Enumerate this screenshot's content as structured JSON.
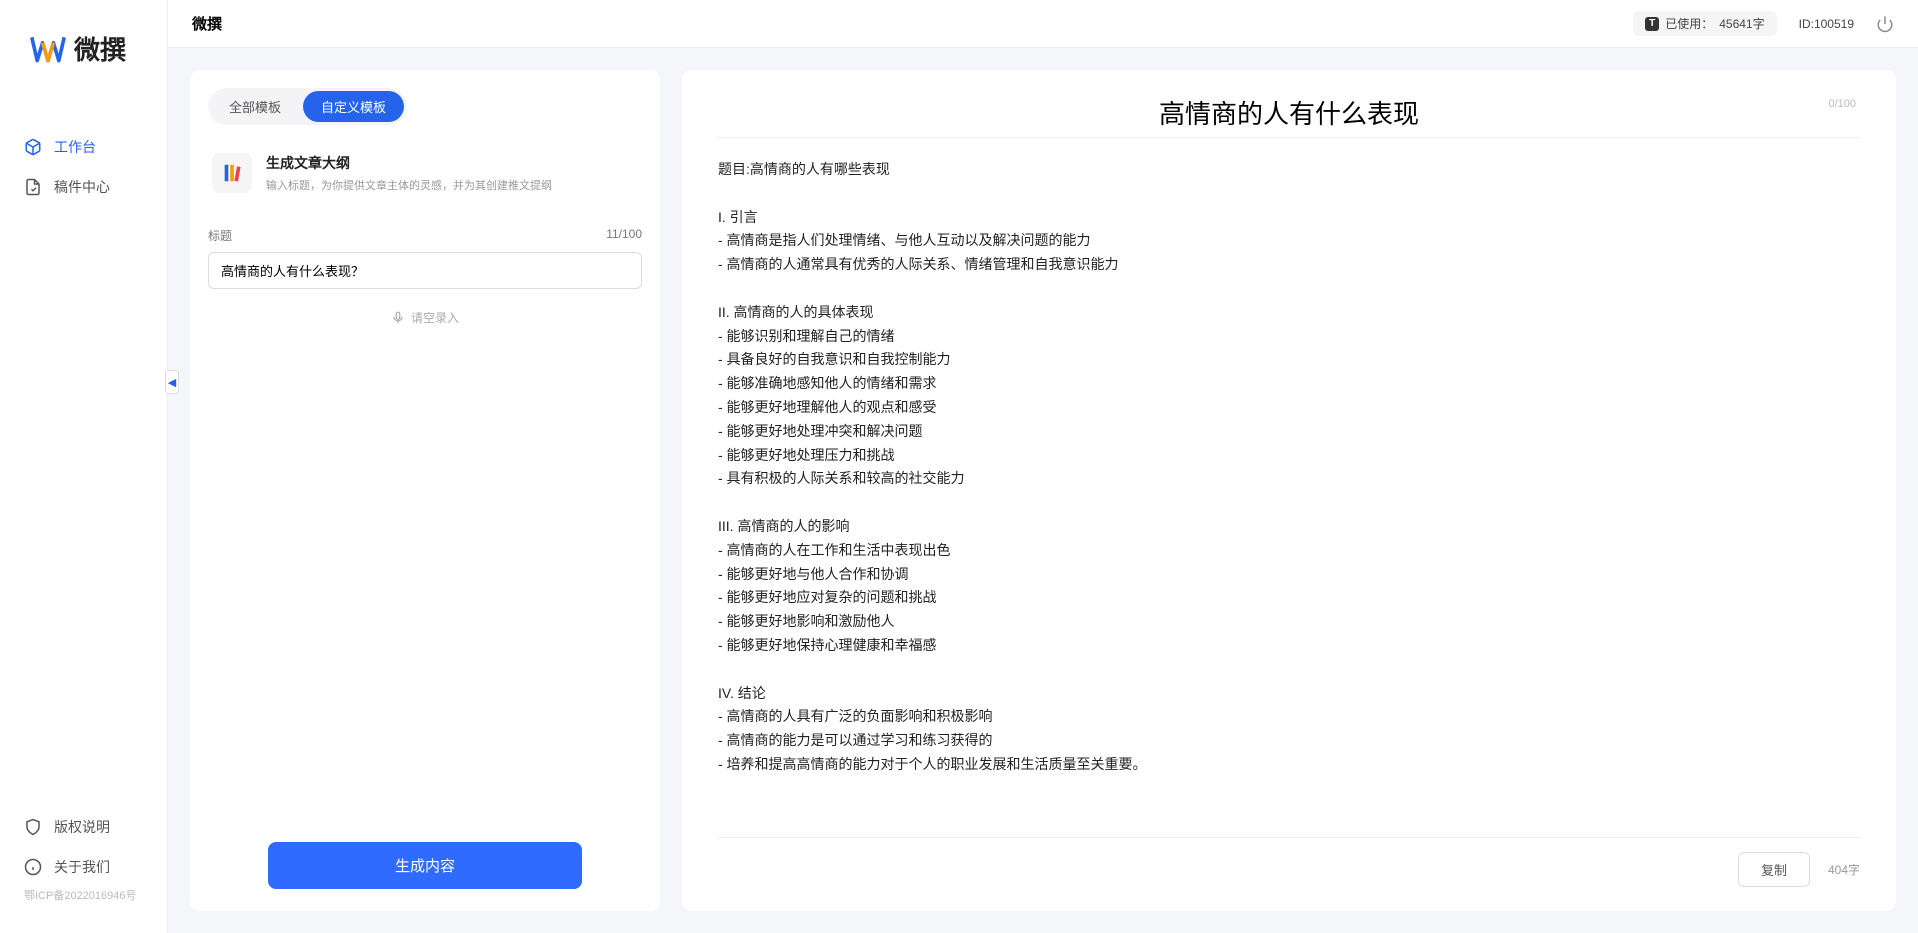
{
  "app_name": "微撰",
  "topbar": {
    "title": "微撰",
    "usage_label": "已使用：",
    "usage_value": "45641字",
    "id_label": "ID:100519"
  },
  "sidebar": {
    "nav": [
      {
        "label": "工作台",
        "active": true
      },
      {
        "label": "稿件中心",
        "active": false
      }
    ],
    "bottom": [
      {
        "label": "版权说明"
      },
      {
        "label": "关于我们"
      }
    ],
    "icp": "鄂ICP备2022016946号"
  },
  "left_panel": {
    "tabs": [
      {
        "label": "全部模板",
        "active": false
      },
      {
        "label": "自定义模板",
        "active": true
      }
    ],
    "template": {
      "title": "生成文章大纲",
      "desc": "输入标题，为你提供文章主体的灵感，并为其创建推文提纲"
    },
    "field_label": "标题",
    "field_counter": "11/100",
    "input_value": "高情商的人有什么表现？",
    "voice_hint": "请空录入",
    "generate_btn": "生成内容"
  },
  "output": {
    "title": "高情商的人有什么表现",
    "top_count": "0/100",
    "body": "题目:高情商的人有哪些表现\n\nI. 引言\n- 高情商是指人们处理情绪、与他人互动以及解决问题的能力\n- 高情商的人通常具有优秀的人际关系、情绪管理和自我意识能力\n\nII. 高情商的人的具体表现\n- 能够识别和理解自己的情绪\n- 具备良好的自我意识和自我控制能力\n- 能够准确地感知他人的情绪和需求\n- 能够更好地理解他人的观点和感受\n- 能够更好地处理冲突和解决问题\n- 能够更好地处理压力和挑战\n- 具有积极的人际关系和较高的社交能力\n\nIII. 高情商的人的影响\n- 高情商的人在工作和生活中表现出色\n- 能够更好地与他人合作和协调\n- 能够更好地应对复杂的问题和挑战\n- 能够更好地影响和激励他人\n- 能够更好地保持心理健康和幸福感\n\nIV. 结论\n- 高情商的人具有广泛的负面影响和积极影响\n- 高情商的能力是可以通过学习和练习获得的\n- 培养和提高高情商的能力对于个人的职业发展和生活质量至关重要。",
    "copy_btn": "复制",
    "word_count": "404字"
  }
}
